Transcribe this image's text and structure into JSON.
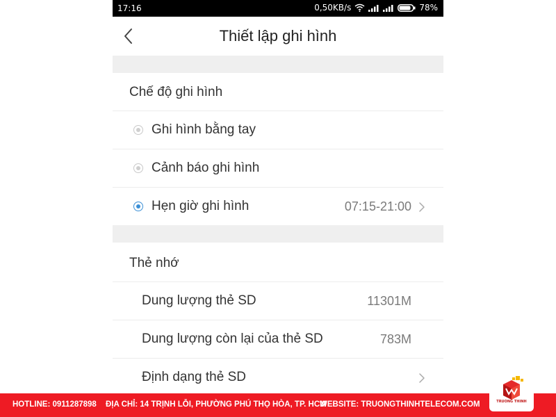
{
  "status_bar": {
    "time": "17:16",
    "speed": "0,50KB/s",
    "battery": "78%"
  },
  "nav": {
    "title": "Thiết lập ghi hình"
  },
  "recording_mode": {
    "heading": "Chế độ ghi hình",
    "options": [
      {
        "label": "Ghi hình bằng tay",
        "checked": false
      },
      {
        "label": "Cảnh báo ghi hình",
        "checked": false
      },
      {
        "label": "Hẹn giờ ghi hình",
        "checked": true,
        "value": "07:15-21:00"
      }
    ]
  },
  "memory_card": {
    "heading": "Thẻ nhớ",
    "rows": [
      {
        "label": "Dung lượng thẻ SD",
        "value": "11301M"
      },
      {
        "label": "Dung lượng còn lại của thẻ SD",
        "value": "783M"
      },
      {
        "label": "Định dạng thẻ SD"
      }
    ]
  },
  "footer": {
    "hotline": "HOTLINE: 0911287898",
    "address": "ĐỊA CHỈ: 14 TRỊNH LỖI, PHƯỜNG PHÚ THỌ HÒA, TP. HCM",
    "website": "WEBSITE: TRUONGTHINHTELECOM.COM"
  },
  "logo": {
    "text": "TRUONG THINH"
  },
  "colors": {
    "accent": "#3b8fd6",
    "footer": "#ee1b24"
  }
}
